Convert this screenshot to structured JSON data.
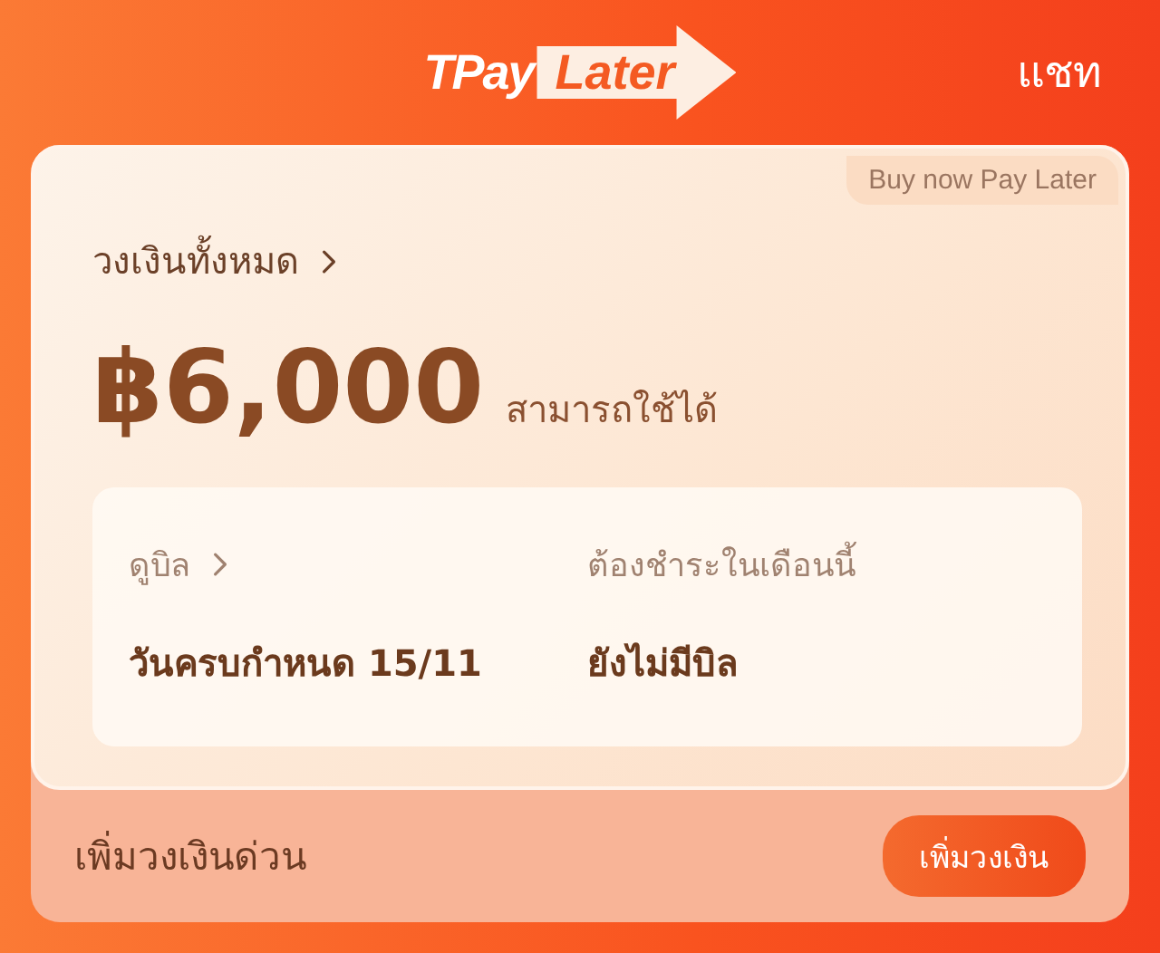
{
  "header": {
    "logo": {
      "left": "TPay",
      "right": "Later"
    },
    "chat": "แชท"
  },
  "card": {
    "tag": "Buy now Pay Later",
    "limit_label": "วงเงินทั้งหมด",
    "amount": "฿6,000",
    "available": "สามารถใช้ได้",
    "bill": {
      "view_label": "ดูบิล",
      "due": "วันครบกำหนด 15/11",
      "month_label": "ต้องชำระในเดือนนี้",
      "status": "ยังไม่มีบิล"
    }
  },
  "footer": {
    "text": "เพิ่มวงเงินด่วน",
    "button": "เพิ่มวงเงิน"
  }
}
